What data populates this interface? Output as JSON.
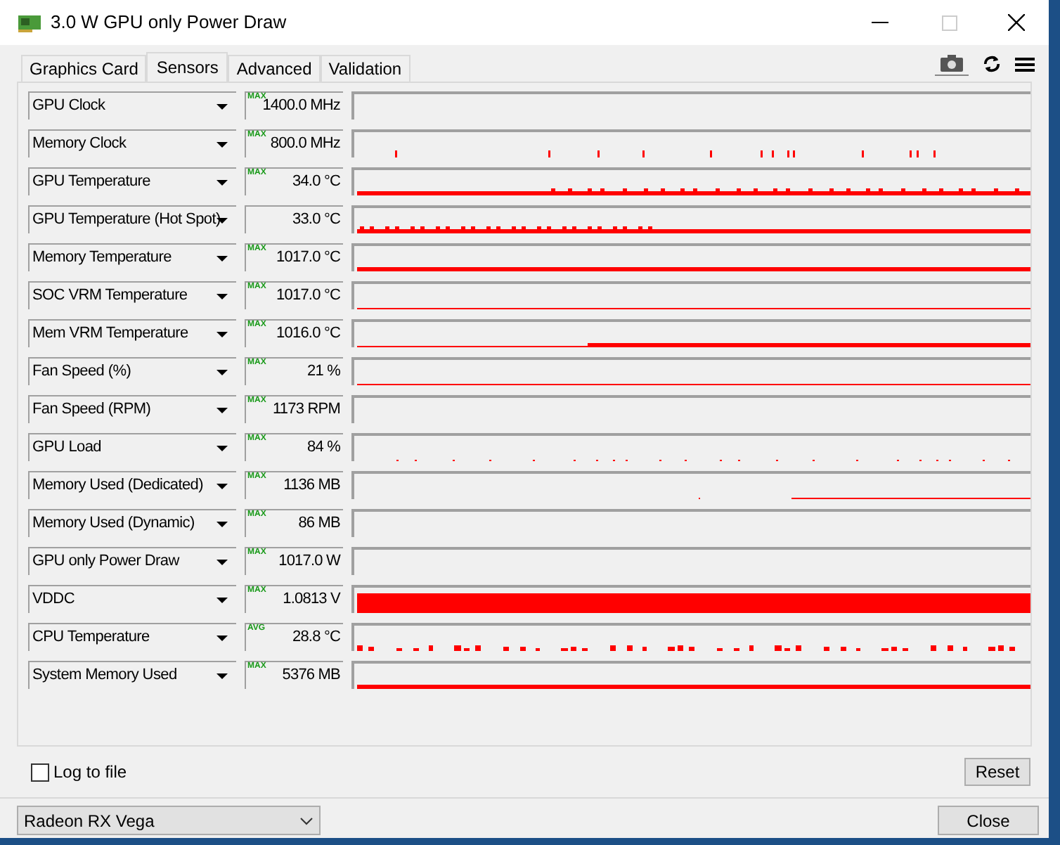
{
  "window": {
    "title": "3.0 W GPU only Power Draw"
  },
  "tabs": [
    {
      "label": "Graphics Card",
      "selected": false
    },
    {
      "label": "Sensors",
      "selected": true
    },
    {
      "label": "Advanced",
      "selected": false
    },
    {
      "label": "Validation",
      "selected": false
    }
  ],
  "sensors": [
    {
      "name": "GPU Clock",
      "badge": "MAX",
      "value": "1400.0 MHz"
    },
    {
      "name": "Memory Clock",
      "badge": "MAX",
      "value": "800.0 MHz"
    },
    {
      "name": "GPU Temperature",
      "badge": "MAX",
      "value": "34.0 °C"
    },
    {
      "name": "GPU Temperature (Hot Spot)",
      "value": "33.0 °C"
    },
    {
      "name": "Memory Temperature",
      "badge": "MAX",
      "value": "1017.0 °C"
    },
    {
      "name": "SOC VRM Temperature",
      "badge": "MAX",
      "value": "1017.0 °C"
    },
    {
      "name": "Mem VRM Temperature",
      "badge": "MAX",
      "value": "1016.0 °C"
    },
    {
      "name": "Fan Speed (%)",
      "badge": "MAX",
      "value": "21 %"
    },
    {
      "name": "Fan Speed (RPM)",
      "badge": "MAX",
      "value": "1173 RPM"
    },
    {
      "name": "GPU Load",
      "badge": "MAX",
      "value": "84 %"
    },
    {
      "name": "Memory Used (Dedicated)",
      "badge": "MAX",
      "value": "1136 MB"
    },
    {
      "name": "Memory Used (Dynamic)",
      "badge": "MAX",
      "value": "86 MB"
    },
    {
      "name": "GPU only Power Draw",
      "badge": "MAX",
      "value": "1017.0 W"
    },
    {
      "name": "VDDC",
      "badge": "MAX",
      "value": "1.0813 V"
    },
    {
      "name": "CPU Temperature",
      "badge": "AVG",
      "value": "28.8 °C"
    },
    {
      "name": "System Memory Used",
      "badge": "MAX",
      "value": "5376 MB"
    }
  ],
  "log_to_file": {
    "label": "Log to file",
    "checked": false
  },
  "reset_button": "Reset",
  "device_select": {
    "value": "Radeon RX Vega"
  },
  "close_button": "Close"
}
